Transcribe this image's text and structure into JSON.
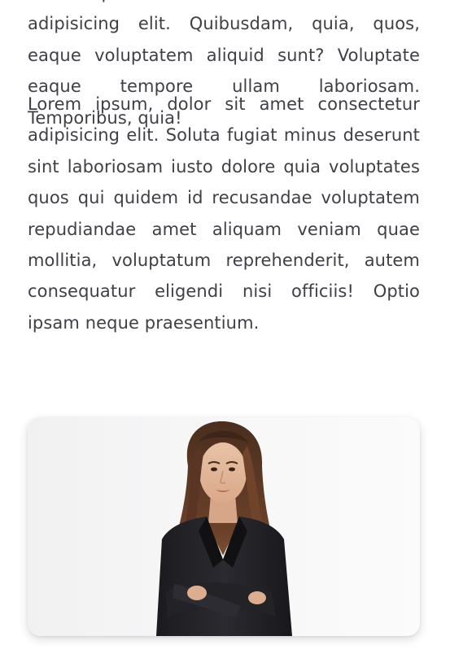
{
  "article": {
    "paragraph_1": "Lorem ipsum dolor sit amet consectetur adipisicing elit. Quibusdam, quia, quos, eaque voluptatem aliquid sunt? Voluptate eaque tempore ullam laboriosam. Temporibus, quia!",
    "paragraph_2": "Lorem ipsum, dolor sit amet consectetur adipisicing elit. Soluta fugiat minus deserunt sint laboriosam iusto dolore quia voluptates quos qui quidem id recusandae voluptatem repudiandae amet aliquam veniam quae mollitia, voluptatum reprehenderit, autem consequatur eligendi nisi officiis! Optio ipsam neque praesentium."
  },
  "colors": {
    "text": "#3f3f46",
    "background": "#ffffff",
    "photo_background": "#f6f6f7"
  }
}
